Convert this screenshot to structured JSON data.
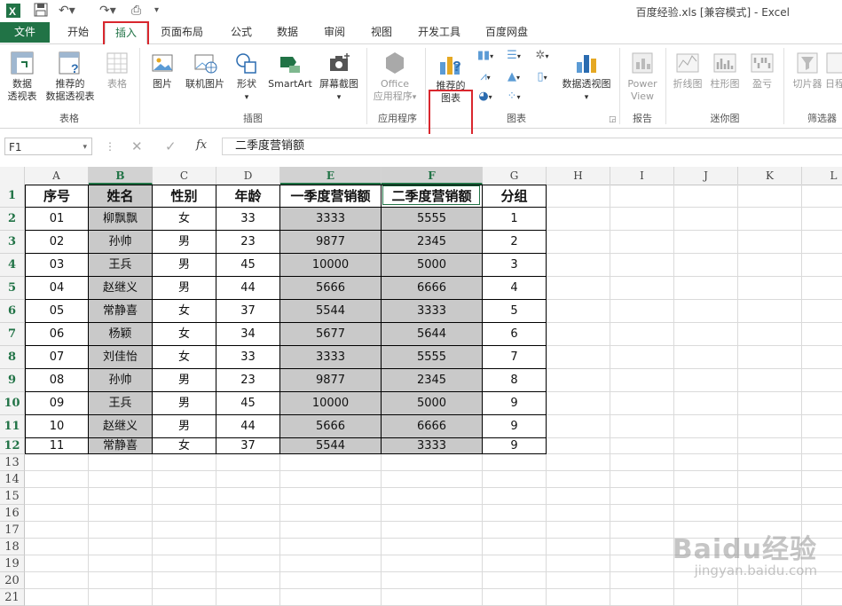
{
  "window": {
    "title": "百度经验.xls  [兼容模式] - Excel"
  },
  "tabs": [
    {
      "id": "file",
      "label": "文件"
    },
    {
      "id": "home",
      "label": "开始"
    },
    {
      "id": "insert",
      "label": "插入"
    },
    {
      "id": "pagelayout",
      "label": "页面布局"
    },
    {
      "id": "formulas",
      "label": "公式"
    },
    {
      "id": "data",
      "label": "数据"
    },
    {
      "id": "review",
      "label": "审阅"
    },
    {
      "id": "view",
      "label": "视图"
    },
    {
      "id": "developer",
      "label": "开发工具"
    },
    {
      "id": "baidupan",
      "label": "百度网盘"
    }
  ],
  "ribbon": {
    "groups": {
      "tables": "表格",
      "illustrations": "插图",
      "apps": "应用程序",
      "charts": "图表",
      "reports": "报告",
      "sparklines": "迷你图",
      "filters": "筛选器"
    },
    "buttons": {
      "pivot_l1": "数据",
      "pivot_l2": "透视表",
      "rec_pivot_l1": "推荐的",
      "rec_pivot_l2": "数据透视表",
      "table": "表格",
      "pictures": "图片",
      "online_pictures": "联机图片",
      "shapes": "形状",
      "smartart": "SmartArt",
      "screenshot": "屏幕截图",
      "office_l1": "Office",
      "office_l2": "应用程序",
      "rec_chart_l1": "推荐的",
      "rec_chart_l2": "图表",
      "pivot_chart": "数据透视图",
      "power_l1": "Power",
      "power_l2": "View",
      "line": "折线图",
      "column": "柱形图",
      "winloss": "盈亏",
      "slicer": "切片器",
      "timeline": "日程"
    }
  },
  "formula_bar": {
    "name_box": "F1",
    "fx_label": "fx",
    "content": "二季度营销额"
  },
  "columns": [
    "A",
    "B",
    "C",
    "D",
    "E",
    "F",
    "G",
    "H",
    "I",
    "J",
    "K",
    "L"
  ],
  "rows": [
    "1",
    "2",
    "3",
    "4",
    "5",
    "6",
    "7",
    "8",
    "9",
    "10",
    "11",
    "12",
    "13",
    "14",
    "15",
    "16",
    "17",
    "18",
    "19",
    "20",
    "21"
  ],
  "table": {
    "headers": [
      "序号",
      "姓名",
      "性别",
      "年龄",
      "一季度营销额",
      "二季度营销额",
      "分组"
    ],
    "rows": [
      [
        "01",
        "柳飘飘",
        "女",
        "33",
        "3333",
        "5555",
        "1"
      ],
      [
        "02",
        "孙帅",
        "男",
        "23",
        "9877",
        "2345",
        "2"
      ],
      [
        "03",
        "王兵",
        "男",
        "45",
        "10000",
        "5000",
        "3"
      ],
      [
        "04",
        "赵继义",
        "男",
        "44",
        "5666",
        "6666",
        "4"
      ],
      [
        "05",
        "常静喜",
        "女",
        "37",
        "5544",
        "3333",
        "5"
      ],
      [
        "06",
        "杨颖",
        "女",
        "34",
        "5677",
        "5644",
        "6"
      ],
      [
        "07",
        "刘佳怡",
        "女",
        "33",
        "3333",
        "5555",
        "7"
      ],
      [
        "08",
        "孙帅",
        "男",
        "23",
        "9877",
        "2345",
        "8"
      ],
      [
        "09",
        "王兵",
        "男",
        "45",
        "10000",
        "5000",
        "9"
      ],
      [
        "10",
        "赵继义",
        "男",
        "44",
        "5666",
        "6666",
        "9"
      ],
      [
        "11",
        "常静喜",
        "女",
        "37",
        "5544",
        "3333",
        "9"
      ]
    ]
  },
  "watermark": {
    "line1": "Baidu经验",
    "line2": "jingyan.baidu.com"
  },
  "colors": {
    "excel_green": "#217346",
    "highlight_red": "#d9272e",
    "selection_gray": "#c9c9c9"
  }
}
